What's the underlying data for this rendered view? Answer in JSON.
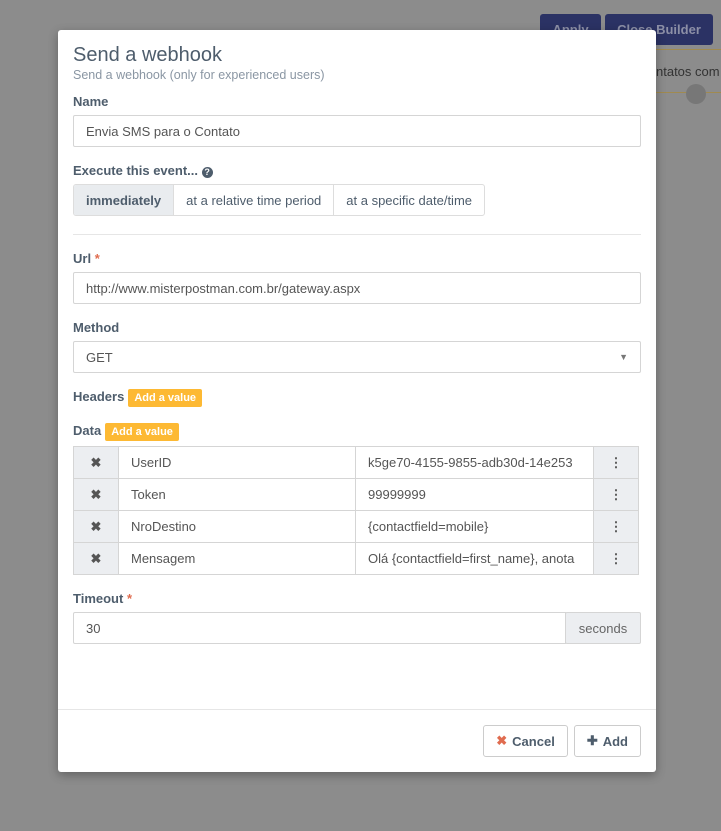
{
  "background": {
    "apply": "Apply",
    "close_builder": "Close Builder",
    "text": "ntatos com"
  },
  "modal": {
    "title": "Send a webhook",
    "subtitle": "Send a webhook (only for experienced users)",
    "name_label": "Name",
    "name_value": "Envia SMS para o Contato",
    "execute_label": "Execute this event...",
    "execute_options": [
      "immediately",
      "at a relative time period",
      "at a specific date/time"
    ],
    "url_label": "Url",
    "url_value": "http://www.misterpostman.com.br/gateway.aspx",
    "method_label": "Method",
    "method_value": "GET",
    "headers_label": "Headers",
    "add_value": "Add a value",
    "data_label": "Data",
    "data_rows": [
      {
        "key": "UserID",
        "value": "k5ge70-4155-9855-adb30d-14e253"
      },
      {
        "key": "Token",
        "value": "99999999"
      },
      {
        "key": "NroDestino",
        "value": "{contactfield=mobile}"
      },
      {
        "key": "Mensagem",
        "value": "Olá {contactfield=first_name}, anota"
      }
    ],
    "timeout_label": "Timeout",
    "timeout_value": "30",
    "timeout_unit": "seconds",
    "cancel": "Cancel",
    "add": "Add",
    "required": "*"
  },
  "colors": {
    "accent": "#fdb933",
    "danger": "#e06c4f"
  }
}
